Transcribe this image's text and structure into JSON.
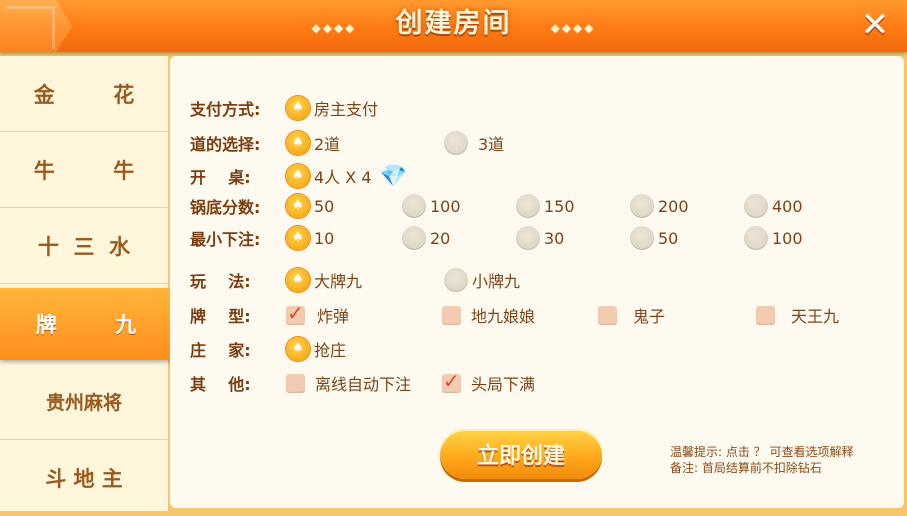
{
  "header": {
    "title": "创建房间",
    "deco_left": "◆◆◆◆",
    "deco_right": "◆◆◆◆",
    "close_glyph": "✕"
  },
  "sidebar": {
    "items": [
      {
        "label": "金        花"
      },
      {
        "label": "牛        牛"
      },
      {
        "label": "十  三  水"
      },
      {
        "label": "牌        九"
      },
      {
        "label": "贵州麻将"
      },
      {
        "label": "斗 地 主"
      }
    ],
    "active_index": 3
  },
  "form": {
    "payment": {
      "label": "支付方式:",
      "options": [
        "房主支付"
      ]
    },
    "lanes": {
      "label": "道的选择:",
      "options": [
        "2道",
        "3道"
      ]
    },
    "table": {
      "label": "开    桌:",
      "options": [
        "4人 X 4"
      ]
    },
    "base_score": {
      "label": "锅底分数:",
      "options": [
        "50",
        "100",
        "150",
        "200",
        "400"
      ]
    },
    "min_bet": {
      "label": "最小下注:",
      "options": [
        "10",
        "20",
        "30",
        "50",
        "100"
      ]
    },
    "mode": {
      "label": "玩    法:",
      "options": [
        "大牌九",
        "小牌九"
      ]
    },
    "card_type": {
      "label": "牌    型:",
      "options": [
        "炸弹",
        "地九娘娘",
        "鬼子",
        "天王九"
      ]
    },
    "banker": {
      "label": "庄    家:",
      "options": [
        "抢庄"
      ]
    },
    "other": {
      "label": "其    他:",
      "options": [
        "离线自动下注",
        "头局下满"
      ]
    }
  },
  "create_button": "立即创建",
  "hint": {
    "line1": "温馨提示: 点击 ？ 可查看选项解释",
    "line2": "备注: 首局结算前不扣除钻石"
  },
  "icons": {
    "diamond": "diamond-icon",
    "close": "close-icon",
    "back": "back-arrow-icon"
  },
  "colors": {
    "accent": "#ff8a1c",
    "label": "#7a3d10"
  }
}
